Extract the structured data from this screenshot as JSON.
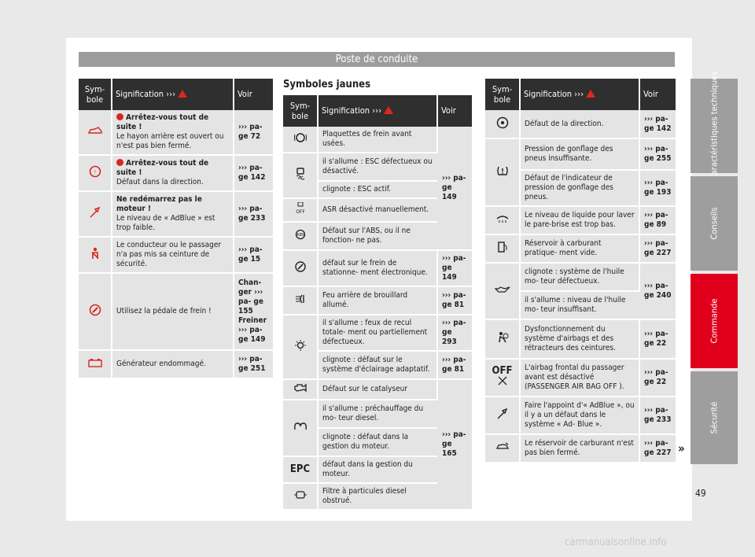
{
  "header": {
    "title": "Poste de conduite"
  },
  "left_table": {
    "col_symbol": "Sym- bole",
    "col_meaning": "Signification ›››",
    "col_see": "Voir",
    "rows": [
      {
        "icon": "car-hatch-open-icon",
        "bold": "Arrêtez-vous tout de suite !",
        "text": "Le hayon arrière est ouvert ou n'est pas bien fermé.",
        "see": "››› pa- ge 72"
      },
      {
        "icon": "steering-fault-icon",
        "bold": "Arrêtez-vous tout de suite !",
        "text": "Défaut dans la direction.",
        "see": "››› pa- ge 142"
      },
      {
        "icon": "adblue-icon",
        "bold": "Ne redémarrez pas le moteur !",
        "text": "Le niveau de « AdBlue » est trop faible.",
        "see": "››› pa- ge 233"
      },
      {
        "icon": "seatbelt-icon",
        "bold": "",
        "text": "Le conducteur ou le passager n'a pas mis sa ceinture de sécurité.",
        "see": "››› pa- ge 15"
      },
      {
        "icon": "brake-pedal-icon",
        "bold": "",
        "text": "Utilisez la pédale de frein !",
        "see": "Chan- ger ››› pa- ge 155 Freiner ››› pa- ge 149"
      },
      {
        "icon": "battery-icon",
        "bold": "",
        "text": "Générateur endommagé.",
        "see": "››› pa- ge 251"
      }
    ]
  },
  "section_title": "Symboles jaunes",
  "mid_table": {
    "col_symbol": "Sym- bole",
    "col_meaning": "Signification ›››",
    "col_see": "Voir",
    "rows": [
      {
        "icon": "brake-pads-icon",
        "text": "Plaquettes de frein avant usées.",
        "see": "››› pa- ge 149"
      },
      {
        "icon": "esc-icon",
        "text": "il s'allume : ESC défectueux ou désactivé."
      },
      {
        "text": "clignote : ESC actif."
      },
      {
        "icon": "asr-off-icon",
        "text": "ASR désactivé manuellement.",
        "icon_label": "OFF"
      },
      {
        "icon": "abs-icon",
        "text": "Défaut sur l'ABS, ou il ne fonction- ne pas.",
        "icon_label": "ABS"
      },
      {
        "icon": "parking-brake-icon",
        "text": "défaut sur le frein de stationne- ment électronique.",
        "see": "››› pa- ge 149"
      },
      {
        "icon": "rear-fog-icon",
        "text": "Feu arrière de brouillard allumé.",
        "see": "››› pa- ge 81"
      },
      {
        "icon": "bulb-icon",
        "text": "il s'allume : feux de recul totale- ment ou partiellement défectueux.",
        "see": "››› pa- ge 293"
      },
      {
        "text": "clignote : défaut sur le système d'éclairage adaptatif.",
        "see": "››› pa- ge 81"
      },
      {
        "icon": "engine-icon",
        "text": "Défaut sur le catalyseur",
        "see": "››› pa- ge 165"
      },
      {
        "icon": "glow-plug-icon",
        "text": "il s'allume : préchauffage du mo- teur diesel."
      },
      {
        "text": "clignote : défaut dans la gestion du moteur."
      },
      {
        "icon": "epc-icon",
        "text": "défaut dans la gestion du moteur.",
        "icon_label": "EPC"
      },
      {
        "icon": "particle-filter-icon",
        "text": "Filtre à particules diesel obstrué."
      }
    ]
  },
  "right_table": {
    "col_symbol": "Sym- bole",
    "col_meaning": "Signification ›››",
    "col_see": "Voir",
    "rows": [
      {
        "icon": "steering-icon",
        "text": "Défaut de la direction.",
        "see": "››› pa- ge 142"
      },
      {
        "icon": "tyre-pressure-icon",
        "text": "Pression de gonflage des pneus insuffisante.",
        "see": "››› pa- ge 255"
      },
      {
        "text": "Défaut de l'indicateur de pression de gonflage des pneus.",
        "see": "››› pa- ge 193"
      },
      {
        "icon": "washer-fluid-icon",
        "text": "Le niveau de liquide pour laver le pare-brise est trop bas.",
        "see": "››› pa- ge 89"
      },
      {
        "icon": "fuel-icon",
        "text": "Réservoir à carburant pratique- ment vide.",
        "see": "››› pa- ge 227"
      },
      {
        "icon": "oil-icon",
        "text": "clignote : système de l'huile mo- teur défectueux.",
        "see": "››› pa- ge 240"
      },
      {
        "text": "il s'allume : niveau de l'huile mo- teur insuffisant."
      },
      {
        "icon": "airbag-icon",
        "text": "Dysfonctionnement du système d'airbags et des rétracteurs des ceintures.",
        "see": "››› pa- ge 22"
      },
      {
        "icon": "airbag-off-icon",
        "text": "L'airbag frontal du passager avant est désactivé (PASSENGER AIR BAG OFF ).",
        "see": "››› pa- ge 22",
        "icon_label": "OFF"
      },
      {
        "icon": "adblue-icon",
        "text": "Faire l'appoint d'« AdBlue », ou il y a un défaut dans le système « Ad- Blue ».",
        "see": "››› pa- ge 233"
      },
      {
        "icon": "fuel-cap-icon",
        "text": "Le réservoir de carburant n'est pas bien fermé.",
        "see": "››› pa- ge 227"
      }
    ]
  },
  "side_tabs": [
    "Caractéristiques techniques",
    "Conseils",
    "Commande",
    "Sécurité"
  ],
  "page_number": "49",
  "continue_mark": "»",
  "watermark": "carmanualsonline.info",
  "colors": {
    "header": "#9c9c9c",
    "table_head": "#2f2f2f",
    "row_bg": "#e4e4e4",
    "active_tab": "#e0001b",
    "tab": "#9e9e9e",
    "warning": "#e1261c"
  }
}
